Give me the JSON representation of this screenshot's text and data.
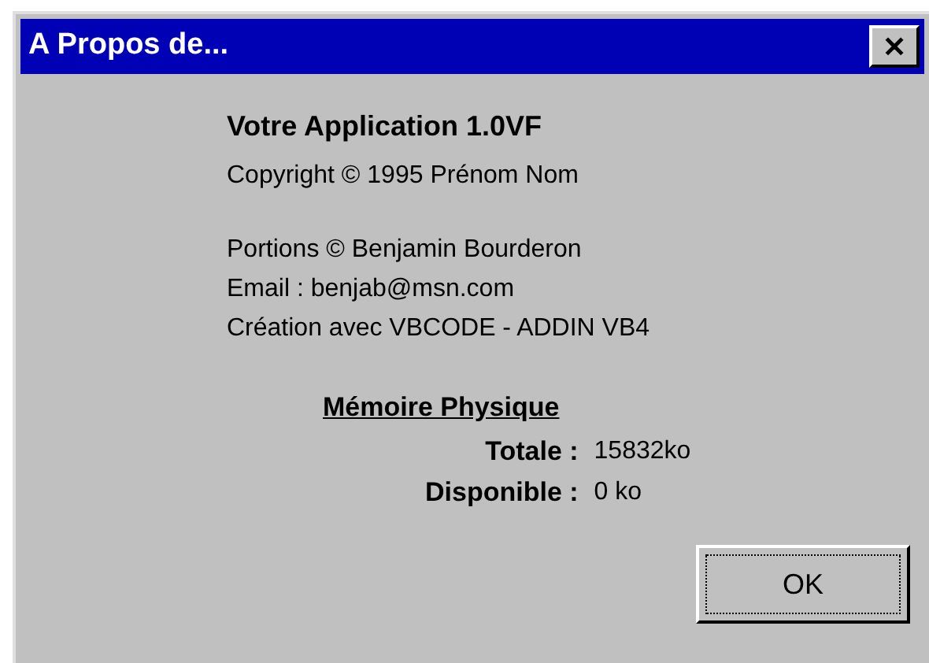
{
  "window": {
    "title": "A Propos de...",
    "close_glyph": "✕"
  },
  "app_title": "Votre Application 1.0VF",
  "copyright": "Copyright © 1995 Prénom Nom",
  "credits": [
    "Portions © Benjamin Bourderon",
    "Email : benjab@msn.com",
    "Création avec VBCODE - ADDIN VB4"
  ],
  "memory": {
    "heading": "Mémoire Physique",
    "rows": [
      {
        "label": "Totale :",
        "value": "15832ko"
      },
      {
        "label": "Disponible :",
        "value": "0 ko"
      }
    ]
  },
  "buttons": [
    {
      "label": "OK",
      "focused": true
    }
  ]
}
